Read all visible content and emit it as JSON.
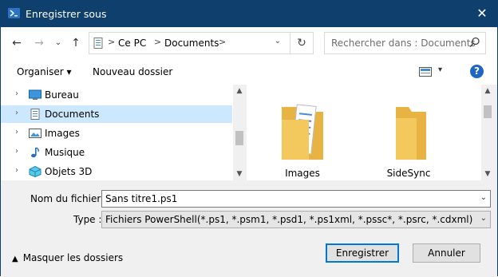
{
  "window": {
    "title": "Enregistrer sous",
    "close_glyph": "✕",
    "icon": "powershell-icon"
  },
  "nav": {
    "back_glyph": "←",
    "forward_glyph": "→",
    "dropdown_glyph": "⌄",
    "up_glyph": "↑",
    "address": {
      "crumbs": [
        "Ce PC",
        "Documents"
      ],
      "separator": ">",
      "dropdown_glyph": "⌄",
      "refresh_glyph": "↻"
    },
    "search_placeholder": "Rechercher dans : Documents"
  },
  "toolbar": {
    "organize_label": "Organiser ▾",
    "new_folder_label": "Nouveau dossier",
    "view_dropdown_glyph": "▾",
    "help_label": "?"
  },
  "tree": {
    "chevron": "›",
    "items": [
      {
        "label": "Bureau",
        "icon": "desktop-icon",
        "selected": false
      },
      {
        "label": "Documents",
        "icon": "documents-icon",
        "selected": true
      },
      {
        "label": "Images",
        "icon": "images-icon",
        "selected": false
      },
      {
        "label": "Musique",
        "icon": "music-icon",
        "selected": false
      },
      {
        "label": "Objets 3D",
        "icon": "objects-3d-icon",
        "selected": false
      }
    ]
  },
  "scroll": {
    "up_glyph": "▲",
    "down_glyph": "▼"
  },
  "files": [
    {
      "label": "Images",
      "icon": "folder-images-icon"
    },
    {
      "label": "SideSync",
      "icon": "folder-icon"
    }
  ],
  "form": {
    "filename_label": "Nom du fichier :",
    "filename_value": "Sans titre1.ps1",
    "type_label": "Type :",
    "type_value": "Fichiers PowerShell(*.ps1, *.psm1, *.psd1, *.ps1xml, *.pssc*, *.psrc, *.cdxml)",
    "dropdown_glyph": "⌄"
  },
  "footer": {
    "hide_folders_caret": "▲",
    "hide_folders_label": "Masquer les dossiers",
    "save_label": "Enregistrer",
    "cancel_label": "Annuler"
  },
  "colors": {
    "titlebar": "#0e3f6d",
    "selection": "#cce8ff",
    "primary_border": "#0078d7",
    "folder": "#f3c85c",
    "help": "#1e66c1"
  }
}
